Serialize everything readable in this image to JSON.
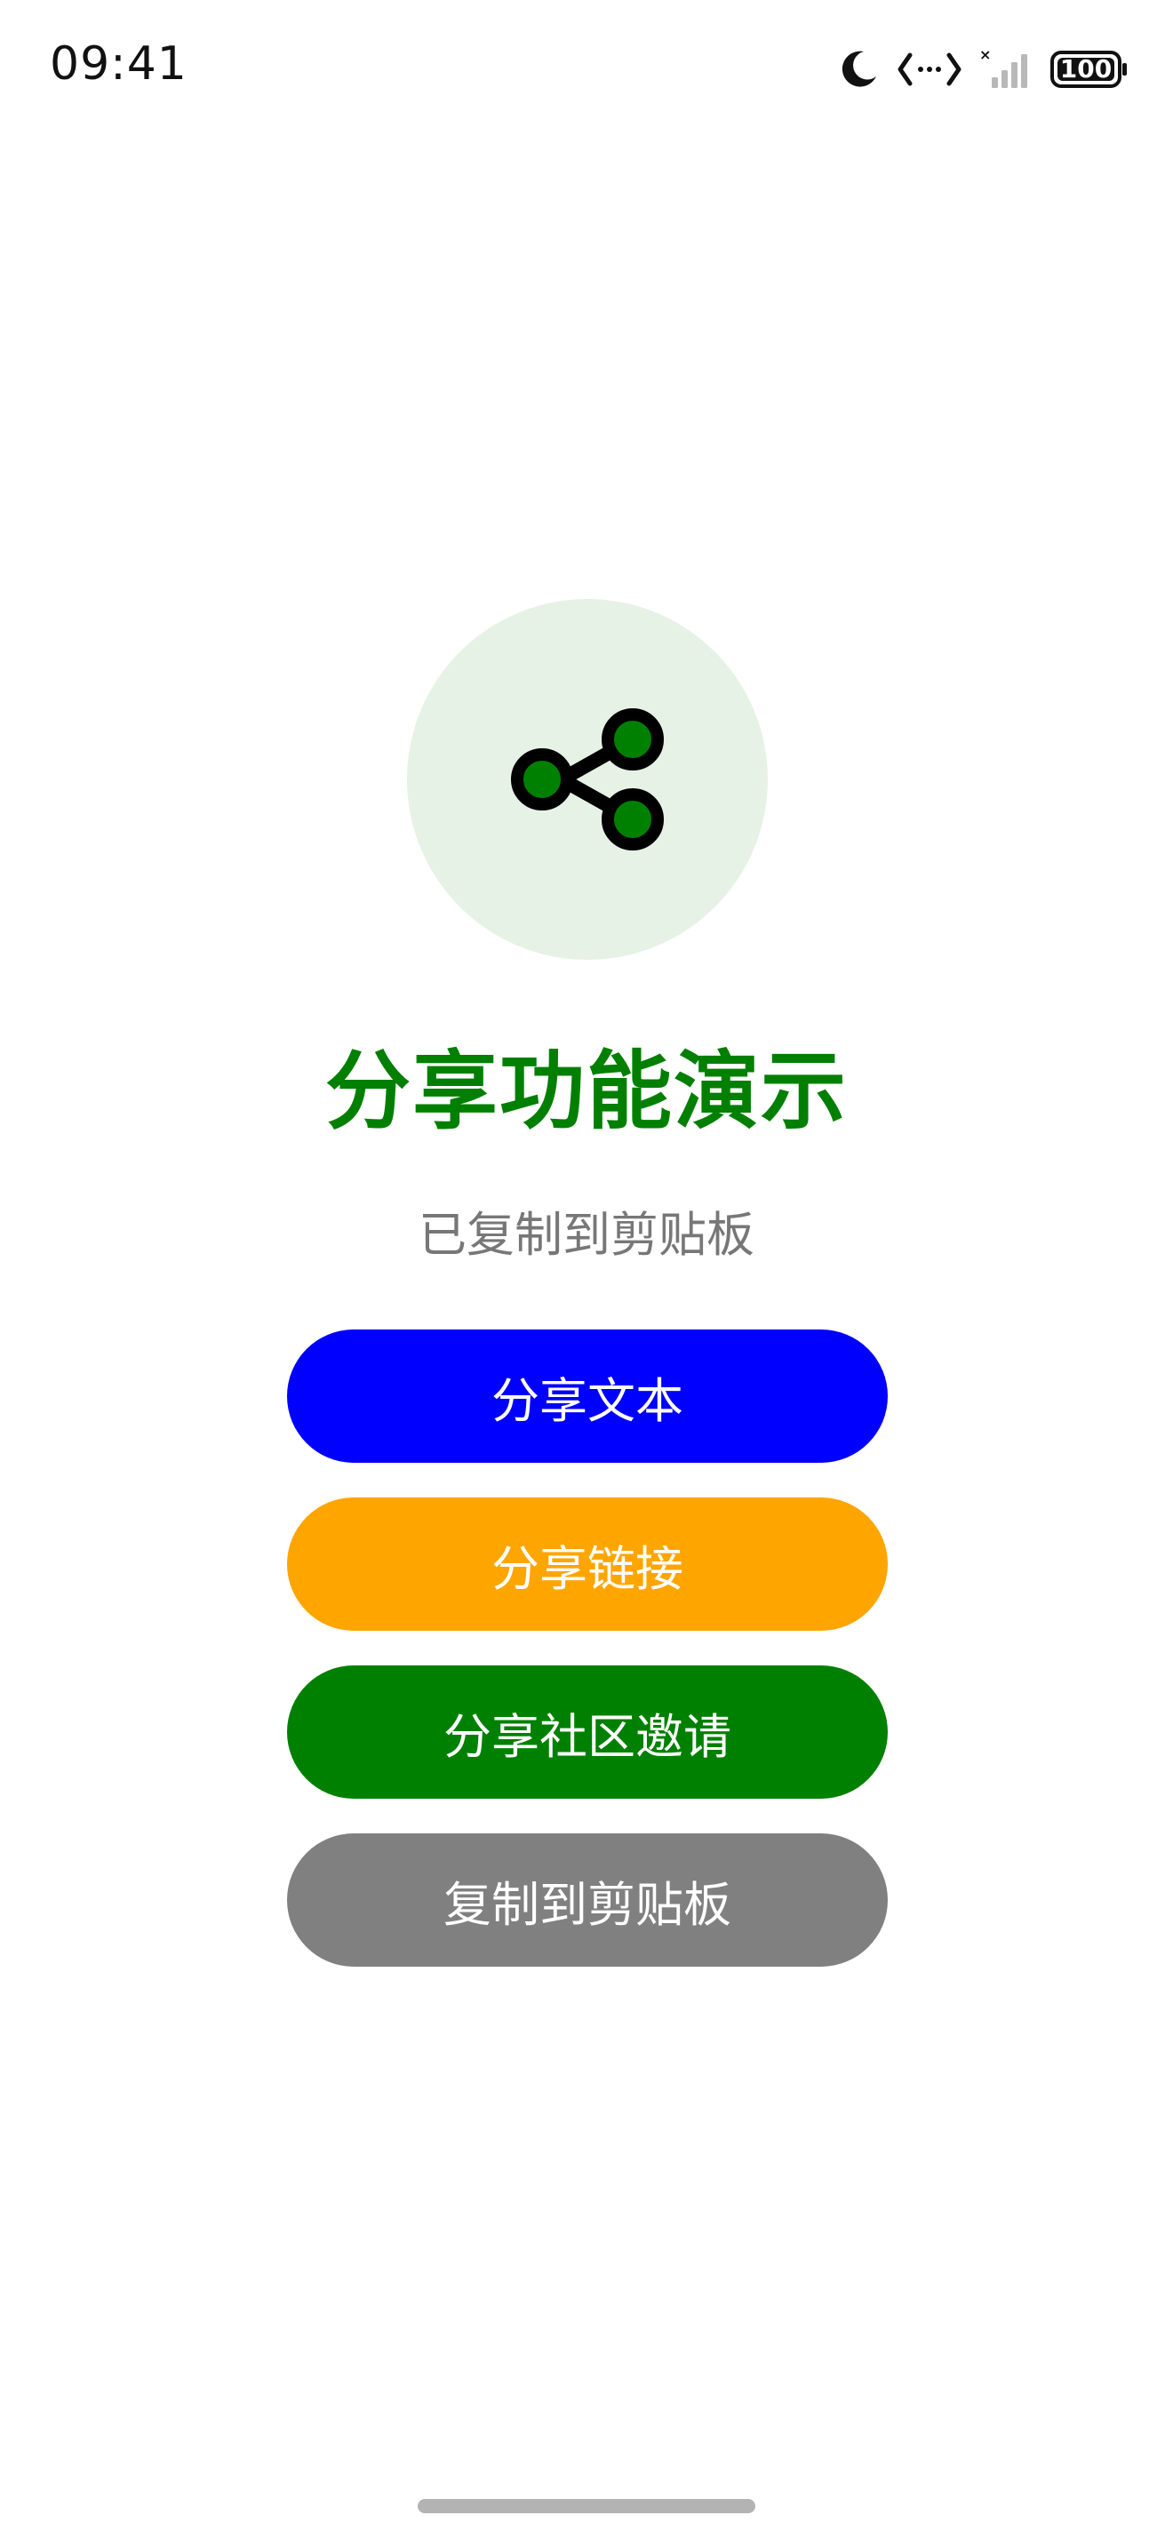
{
  "status_bar": {
    "time": "09:41",
    "battery": "100",
    "icons": [
      "moon-icon",
      "data-transfer-icon",
      "signal-icon",
      "battery-icon"
    ]
  },
  "hero": {
    "icon": "share-icon",
    "circle_color": "#e6f2e6",
    "icon_fill": "#008000"
  },
  "title": "分享功能演示",
  "status_message": "已复制到剪贴板",
  "buttons": {
    "share_text": "分享文本",
    "share_link": "分享链接",
    "share_invite": "分享社区邀请",
    "copy_clipboard": "复制到剪贴板"
  },
  "colors": {
    "title": "#007f00",
    "share_text": "#0000ff",
    "share_link": "#ffa500",
    "share_invite": "#008000",
    "copy_clipboard": "#808080"
  }
}
